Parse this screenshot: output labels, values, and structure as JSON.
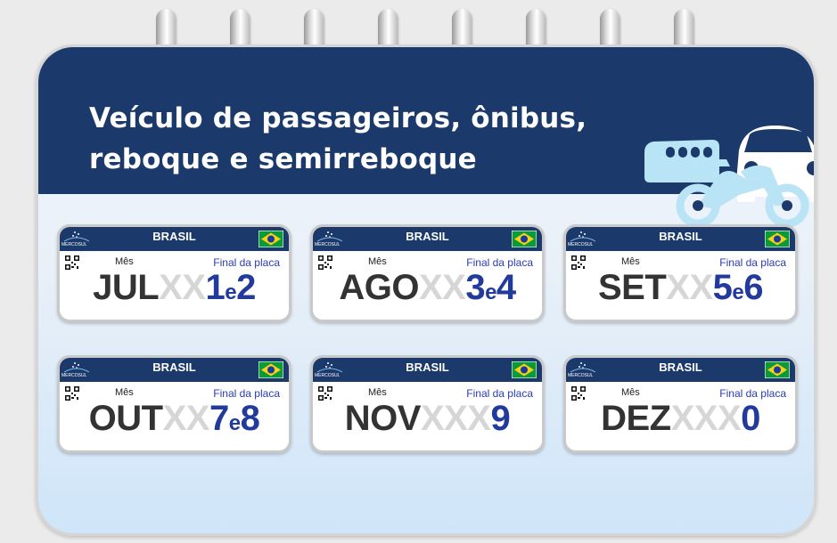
{
  "title": {
    "line1": "Veículo de passageiros, ônibus,",
    "line2": "reboque e semirreboque"
  },
  "colors": {
    "header": "#1b3a6b",
    "digits": "#223a9c",
    "month": "#333333",
    "mask": "#d6d6d6",
    "vehicles": "#b8e4f5"
  },
  "icons": [
    "bus-icon",
    "car-icon",
    "motorcycle-icon",
    "brazil-flag-icon",
    "qr-code-icon",
    "mercosul-logo-icon"
  ],
  "plates": [
    {
      "country": "BRASIL",
      "mercosul": "MERCOSUL",
      "month_label": "Mês",
      "final_label": "Final da placa",
      "month": "JUL",
      "mask": "XX",
      "digit1": "1",
      "sep": "e",
      "digit2": "2"
    },
    {
      "country": "BRASIL",
      "mercosul": "MERCOSUL",
      "month_label": "Mês",
      "final_label": "Final da placa",
      "month": "AGO",
      "mask": "XX",
      "digit1": "3",
      "sep": "e",
      "digit2": "4"
    },
    {
      "country": "BRASIL",
      "mercosul": "MERCOSUL",
      "month_label": "Mês",
      "final_label": "Final da placa",
      "month": "SET",
      "mask": "XX",
      "digit1": "5",
      "sep": "e",
      "digit2": "6"
    },
    {
      "country": "BRASIL",
      "mercosul": "MERCOSUL",
      "month_label": "Mês",
      "final_label": "Final da placa",
      "month": "OUT",
      "mask": "XX",
      "digit1": "7",
      "sep": "e",
      "digit2": "8"
    },
    {
      "country": "BRASIL",
      "mercosul": "MERCOSUL",
      "month_label": "Mês",
      "final_label": "Final da placa",
      "month": "NOV",
      "mask": "XXX",
      "digit1": "9",
      "sep": "",
      "digit2": ""
    },
    {
      "country": "BRASIL",
      "mercosul": "MERCOSUL",
      "month_label": "Mês",
      "final_label": "Final da placa",
      "month": "DEZ",
      "mask": "XXX",
      "digit1": "0",
      "sep": "",
      "digit2": ""
    }
  ]
}
